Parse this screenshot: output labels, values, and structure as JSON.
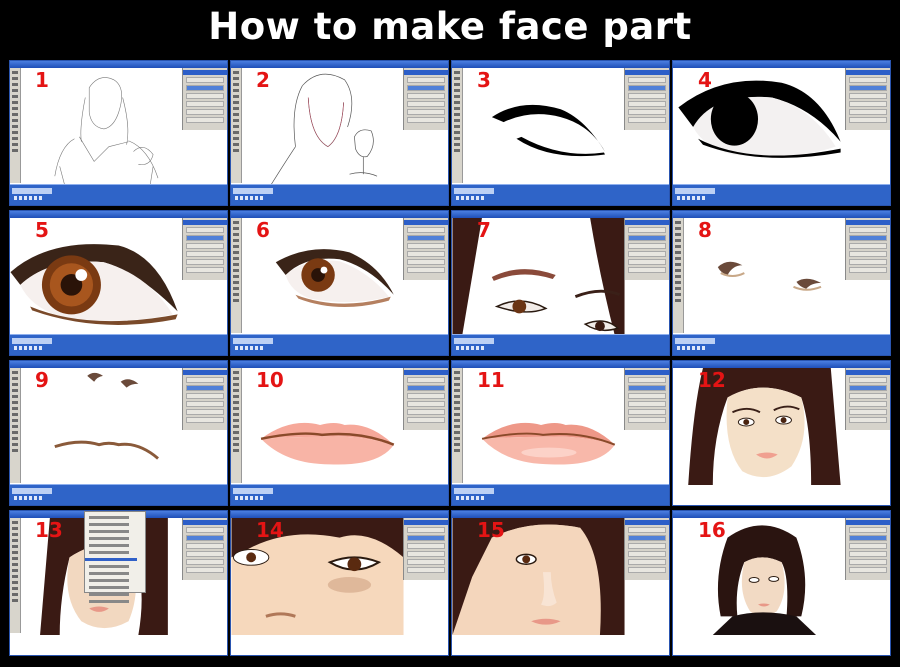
{
  "title": "How to make face part",
  "colors": {
    "background": "#000000",
    "title": "#ffffff",
    "step_number": "#e41414",
    "window_blue": "#2f64c8"
  },
  "panels": [
    {
      "step": "1"
    },
    {
      "step": "2"
    },
    {
      "step": "3"
    },
    {
      "step": "4"
    },
    {
      "step": "5"
    },
    {
      "step": "6"
    },
    {
      "step": "7"
    },
    {
      "step": "8"
    },
    {
      "step": "9"
    },
    {
      "step": "10"
    },
    {
      "step": "11"
    },
    {
      "step": "12"
    },
    {
      "step": "13"
    },
    {
      "step": "14"
    },
    {
      "step": "15"
    },
    {
      "step": "16"
    }
  ]
}
